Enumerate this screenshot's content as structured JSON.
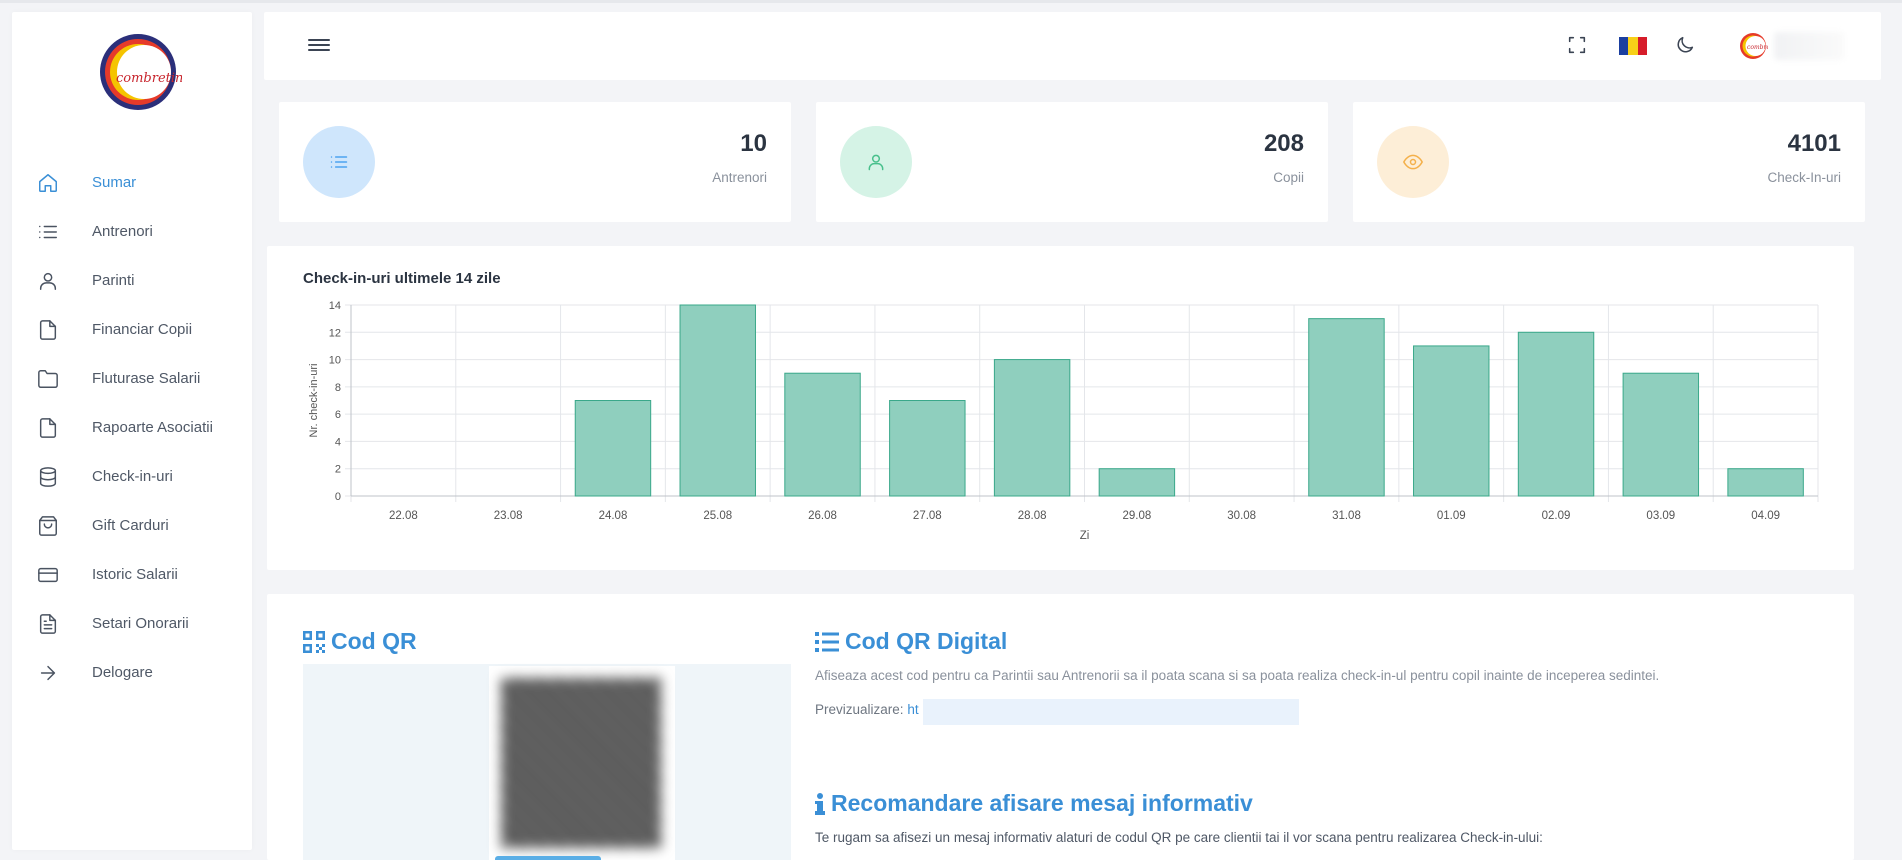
{
  "app": {
    "brand": "combretina"
  },
  "sidebar": {
    "items": [
      {
        "label": "Sumar",
        "icon": "home-icon",
        "active": true
      },
      {
        "label": "Antrenori",
        "icon": "list-icon"
      },
      {
        "label": "Parinti",
        "icon": "user-icon"
      },
      {
        "label": "Financiar Copii",
        "icon": "file-icon"
      },
      {
        "label": "Fluturase Salarii",
        "icon": "folder-icon"
      },
      {
        "label": "Rapoarte Asociatii",
        "icon": "file-icon"
      },
      {
        "label": "Check-in-uri",
        "icon": "database-icon"
      },
      {
        "label": "Gift Carduri",
        "icon": "shopping-bag-icon"
      },
      {
        "label": "Istoric Salarii",
        "icon": "credit-card-icon"
      },
      {
        "label": "Setari Onorarii",
        "icon": "file-text-icon"
      },
      {
        "label": "Delogare",
        "icon": "arrow-right-icon"
      }
    ]
  },
  "topbar": {
    "menu_icon": "hamburger-icon",
    "fullscreen_icon": "fullscreen-icon",
    "language_flag": "romania-flag",
    "theme_icon": "moon-icon"
  },
  "stats": [
    {
      "value": "10",
      "label": "Antrenori",
      "icon": "list-icon",
      "bg": "#cfe6fc",
      "fg": "#4da3f0"
    },
    {
      "value": "208",
      "label": "Copii",
      "icon": "user-icon",
      "bg": "#d5f3e6",
      "fg": "#48c08c"
    },
    {
      "value": "4101",
      "label": "Check-In-uri",
      "icon": "eye-icon",
      "bg": "#fdeed7",
      "fg": "#f4b04a"
    }
  ],
  "chart": {
    "title": "Check-in-uri ultimele 14 zile"
  },
  "chart_data": {
    "type": "bar",
    "title": "Check-in-uri ultimele 14 zile",
    "xlabel": "Zi",
    "ylabel": "Nr. check-in-uri",
    "categories": [
      "22.08",
      "23.08",
      "24.08",
      "25.08",
      "26.08",
      "27.08",
      "28.08",
      "29.08",
      "30.08",
      "31.08",
      "01.09",
      "02.09",
      "03.09",
      "04.09"
    ],
    "values": [
      0,
      0,
      7,
      14,
      9,
      7,
      10,
      2,
      0,
      13,
      11,
      12,
      9,
      2
    ],
    "ylim": [
      0,
      14
    ],
    "yticks": [
      "0",
      "2",
      "4",
      "6",
      "8",
      "10",
      "12",
      "14"
    ],
    "grid": true,
    "bar_color": "#8fcfbe",
    "bar_border": "#3aa88a"
  },
  "qr": {
    "title": "Cod QR",
    "digital_title": "Cod QR Digital",
    "digital_desc": "Afiseaza acest cod pentru ca Parintii sau Antrenorii sa il poata scana si sa poata realiza check-in-ul pentru copil inainte de inceperea sedintei.",
    "preview_label": "Previzualizare:",
    "preview_link": "ht",
    "info_title": "Recomandare afisare mesaj informativ",
    "info_desc": "Te rugam sa afisezi un mesaj informativ alaturi de codul QR pe care clientii tai il vor scana pentru realizarea Check-in-ului:"
  }
}
